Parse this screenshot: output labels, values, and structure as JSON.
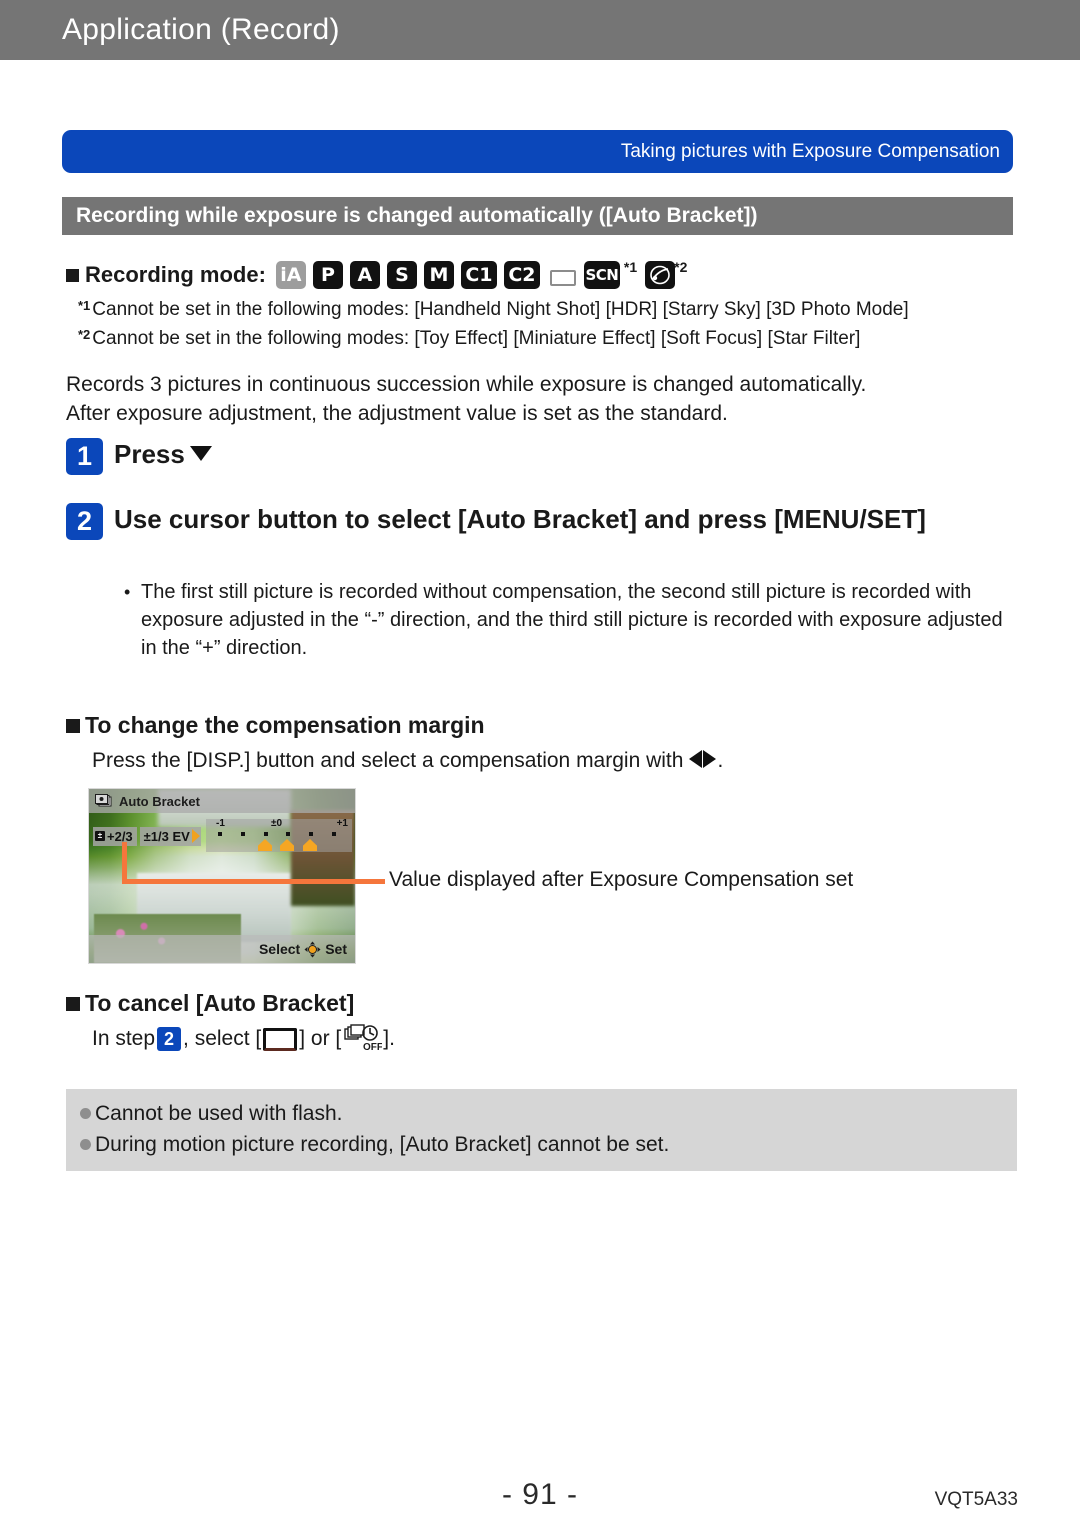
{
  "header": {
    "title": "Application (Record)"
  },
  "banner": {
    "text": "Taking pictures with Exposure Compensation"
  },
  "sub_header": {
    "text": "Recording while exposure is changed automatically ([Auto Bracket])"
  },
  "recording_mode": {
    "label": "Recording mode:",
    "icons": [
      {
        "name": "mode-icon-ia",
        "text": "iA",
        "style": "gray"
      },
      {
        "name": "mode-icon-p",
        "text": "P",
        "style": "black"
      },
      {
        "name": "mode-icon-a",
        "text": "A",
        "style": "black"
      },
      {
        "name": "mode-icon-s",
        "text": "S",
        "style": "black"
      },
      {
        "name": "mode-icon-m",
        "text": "M",
        "style": "black"
      },
      {
        "name": "mode-icon-c1",
        "text": "C1",
        "style": "black"
      },
      {
        "name": "mode-icon-c2",
        "text": "C2",
        "style": "black"
      },
      {
        "name": "mode-icon-panorama",
        "text": "",
        "style": "pano"
      },
      {
        "name": "mode-icon-scn",
        "text": "SCN",
        "style": "black",
        "footnote": "*1"
      },
      {
        "name": "mode-icon-creative-control",
        "text": "",
        "style": "creative",
        "footnote": "*2"
      }
    ]
  },
  "footnotes": [
    {
      "mark": "*1",
      "text": "Cannot be set in the following modes: [Handheld Night Shot] [HDR] [Starry Sky] [3D Photo Mode]"
    },
    {
      "mark": "*2",
      "text": "Cannot be set in the following modes: [Toy Effect] [Miniature Effect] [Soft Focus] [Star Filter]"
    }
  ],
  "intro": {
    "line1": "Records 3 pictures in continuous succession while exposure is changed automatically.",
    "line2": "After exposure adjustment, the adjustment value is set as the standard."
  },
  "steps": [
    {
      "number": "1",
      "text": "Press"
    },
    {
      "number": "2",
      "text": "Use cursor button to select [Auto Bracket] and press [MENU/SET]"
    }
  ],
  "step_bullets": [
    "The first still picture is recorded without compensation, the second still picture is recorded with exposure adjusted in the “-” direction, and the third still picture is recorded with exposure adjusted in the “+” direction."
  ],
  "margin_section": {
    "heading": "To change the compensation margin",
    "body_before": "Press the [DISP.] button and select a compensation margin with",
    "body_after": "."
  },
  "camera_screen": {
    "title": "Auto Bracket",
    "title_icon": "auto-bracket-icon",
    "ev_value": "+2/3",
    "ev_step": "±1/3 EV",
    "scale_labels": [
      "-1",
      "±0",
      "+1"
    ],
    "footer_select": "Select",
    "footer_set": "Set",
    "footer_icon": "cursor-button-icon"
  },
  "callout": {
    "text": "Value displayed after Exposure Compensation set",
    "color": "#f5763c"
  },
  "cancel_section": {
    "heading": "To cancel [Auto Bracket]",
    "body_part1": "In step",
    "body_badge": "2",
    "body_part2": ", select [",
    "body_part3": "] or [",
    "body_part4": "]."
  },
  "notes": [
    "Cannot be used with flash.",
    "During motion picture recording, [Auto Bracket] cannot be set."
  ],
  "footer": {
    "page_number": "- 91 -",
    "doc_code": "VQT5A33"
  },
  "colors": {
    "header_gray": "#757575",
    "banner_blue": "#0b47ba",
    "notes_gray": "#d6d6d6",
    "callout_orange": "#f5763c"
  }
}
